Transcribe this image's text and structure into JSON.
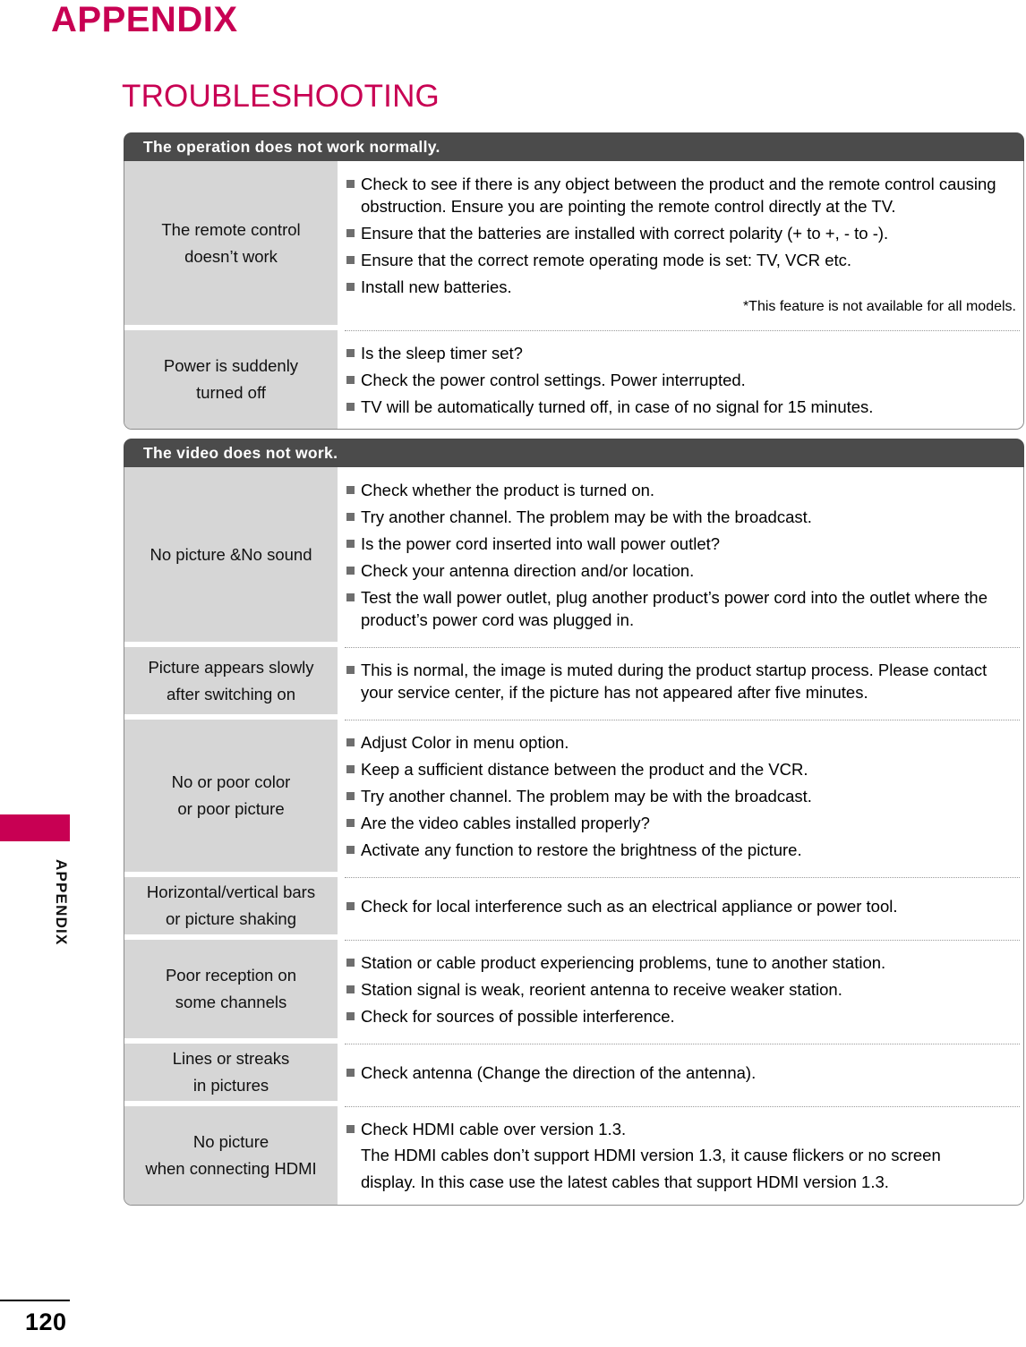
{
  "page": {
    "heading": "APPENDIX",
    "section_title": "TROUBLESHOOTING",
    "side_tab_label": "APPENDIX",
    "page_number": "120",
    "accent_color": "#c80053",
    "header_bar_color": "#4b4b4b",
    "label_cell_color": "#d6d6d6"
  },
  "tables": [
    {
      "header": "The operation does not work normally.",
      "rows": [
        {
          "label_lines": [
            "The remote control",
            "doesn’t work"
          ],
          "bullets": [
            "Check to see if there is any object between the product and the remote control causing obstruction. Ensure you are pointing the remote control directly at the TV.",
            "Ensure that the batteries are installed with correct polarity (+ to +, - to -).",
            "Ensure that the correct remote operating mode is set: TV, VCR etc.",
            "Install new batteries."
          ],
          "note": "*This feature is not available for all models."
        },
        {
          "label_lines": [
            "Power is suddenly",
            "turned off"
          ],
          "bullets": [
            "Is the sleep timer set?",
            "Check the power control settings. Power interrupted.",
            "TV will be automatically turned off, in case of no signal for 15 minutes."
          ]
        }
      ]
    },
    {
      "header": "The video does not work.",
      "rows": [
        {
          "label_lines": [
            "No picture &No sound"
          ],
          "bullets": [
            "Check whether the product is turned on.",
            "Try another channel. The problem may be with the broadcast.",
            "Is the power cord inserted into wall power outlet?",
            "Check your antenna direction and/or location.",
            "Test the wall power outlet, plug another product’s power cord into the outlet where the product’s power cord was plugged in."
          ]
        },
        {
          "label_lines": [
            "Picture appears slowly",
            "after switching on"
          ],
          "bullets": [
            "This is normal, the image is muted during the product startup process. Please contact your service center, if the picture has not appeared after five minutes."
          ]
        },
        {
          "label_lines": [
            "No or poor color",
            "or poor picture"
          ],
          "bullets": [
            "Adjust Color in menu option.",
            "Keep a sufficient distance between the product and the VCR.",
            "Try another channel. The problem may be with the broadcast.",
            "Are the video cables installed properly?",
            "Activate any function to restore the brightness of the picture."
          ]
        },
        {
          "label_lines": [
            "Horizontal/vertical bars",
            "or picture shaking"
          ],
          "bullets": [
            "Check for local interference such as an electrical appliance or power tool."
          ]
        },
        {
          "label_lines": [
            "Poor reception on",
            "some channels"
          ],
          "bullets": [
            "Station or cable product experiencing problems, tune to another station.",
            "Station signal is weak, reorient antenna to receive weaker station.",
            "Check for sources of possible interference."
          ]
        },
        {
          "label_lines": [
            "Lines or streaks",
            "in pictures"
          ],
          "bullets": [
            "Check antenna (Change the direction of the antenna)."
          ]
        },
        {
          "label_lines": [
            "No picture",
            "when connecting HDMI"
          ],
          "bullets": [
            "Check HDMI cable over version 1.3."
          ],
          "plain_lines": [
            "The HDMI cables don’t support HDMI version 1.3, it cause flickers or no screen",
            "display. In this case use the latest cables that support HDMI version 1.3."
          ]
        }
      ]
    }
  ]
}
